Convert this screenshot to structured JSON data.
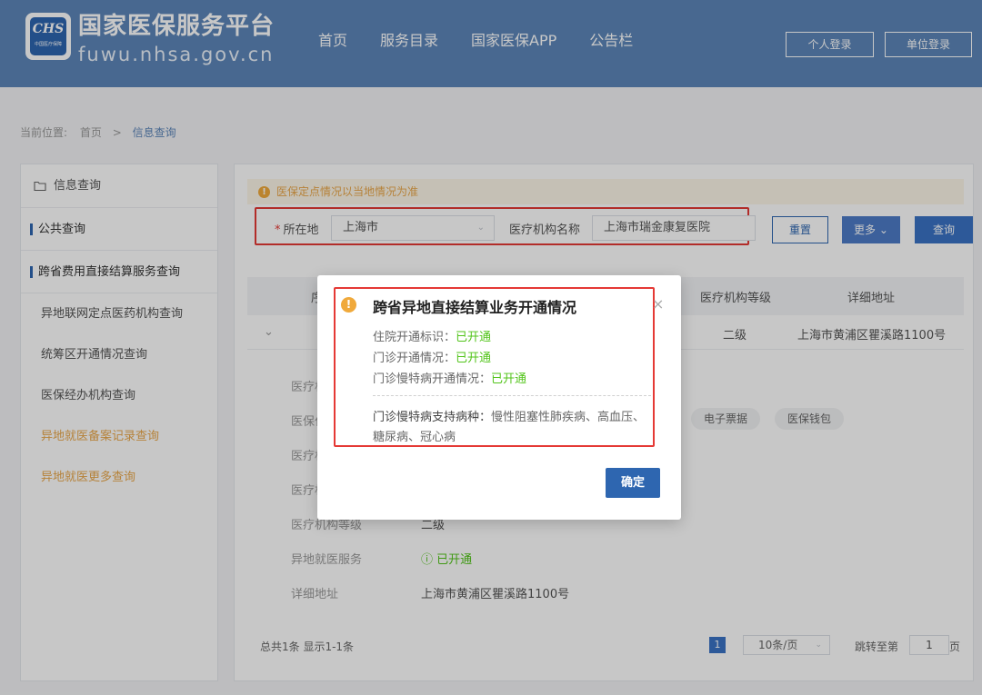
{
  "header": {
    "logo_text": "CHS",
    "logo_small": "中国医疗保障",
    "title": "国家医保服务平台",
    "subtitle": "fuwu.nhsa.gov.cn",
    "nav": [
      "首页",
      "服务目录",
      "国家医保APP",
      "公告栏"
    ],
    "personal_login": "个人登录",
    "org_login": "单位登录"
  },
  "breadcrumb": {
    "label": "当前位置:",
    "home": "首页",
    "sep": ">",
    "current": "信息查询"
  },
  "sidebar": {
    "head": "信息查询",
    "group1": "公共查询",
    "group2": "跨省费用直接结算服务查询",
    "items": [
      "异地联网定点医药机构查询",
      "统筹区开通情况查询",
      "医保经办机构查询",
      "异地就医备案记录查询",
      "异地就医更多查询"
    ]
  },
  "notice": {
    "icon": "!",
    "text": "医保定点情况以当地情况为准"
  },
  "filter": {
    "location_label": "所在地",
    "location_value": "上海市",
    "org_label": "医疗机构名称",
    "org_value": "上海市瑞金康复医院",
    "reset": "重置",
    "more": "更多",
    "query": "查询"
  },
  "table": {
    "headers": [
      "序",
      "医疗机构等级",
      "详细地址"
    ],
    "row": {
      "level": "二级",
      "address": "上海市黄浦区瞿溪路1100号"
    }
  },
  "detail": {
    "rows": [
      {
        "k": "医疗机",
        "v": ""
      },
      {
        "k": "医保付",
        "v": ""
      },
      {
        "k": "医疗机",
        "v": ""
      },
      {
        "k": "医疗机",
        "v": ""
      },
      {
        "k": "医疗机构等级",
        "v": "二级"
      },
      {
        "k": "异地就医服务",
        "v": "已开通"
      },
      {
        "k": "详细地址",
        "v": "上海市黄浦区瞿溪路1100号"
      }
    ],
    "tags": [
      "电子票据",
      "医保钱包"
    ]
  },
  "footer": {
    "summary": "总共1条  显示1-1条",
    "page": "1",
    "page_size": "10条/页",
    "jump_label": "跳转至第",
    "jump_value": "1",
    "page_unit": "页"
  },
  "modal": {
    "title": "跨省异地直接结算业务开通情况",
    "lines": [
      {
        "label": "住院开通标识：",
        "value": "已开通"
      },
      {
        "label": "门诊开通情况：",
        "value": "已开通"
      },
      {
        "label": "门诊慢特病开通情况：",
        "value": "已开通"
      }
    ],
    "disease_label": "门诊慢特病支持病种：",
    "disease_value": "慢性阻塞性肺疾病、高血压、糖尿病、冠心病",
    "close": "×",
    "ok": "确定"
  },
  "colors": {
    "header": "#5d86b9",
    "primary": "#2e66b0",
    "success": "#52c41a",
    "warning": "#f0a93b",
    "highlight": "#e53935"
  }
}
